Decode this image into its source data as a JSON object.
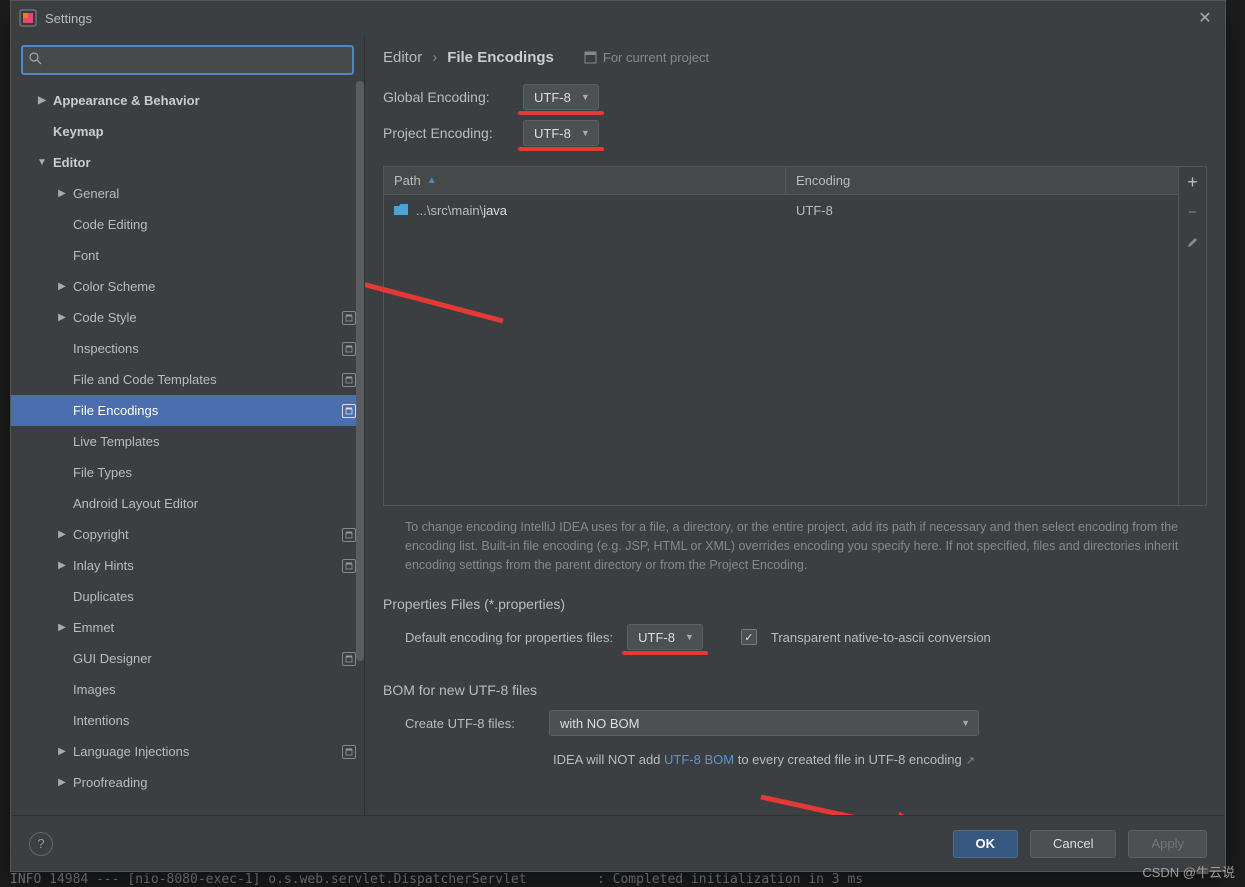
{
  "window": {
    "title": "Settings"
  },
  "search": {
    "value": "",
    "placeholder": ""
  },
  "tree": [
    {
      "label": "Appearance & Behavior",
      "level": 1,
      "arrow": "right",
      "bold": true
    },
    {
      "label": "Keymap",
      "level": 1,
      "arrow": "none",
      "bold": true
    },
    {
      "label": "Editor",
      "level": 1,
      "arrow": "down",
      "bold": true
    },
    {
      "label": "General",
      "level": 2,
      "arrow": "right"
    },
    {
      "label": "Code Editing",
      "level": 2,
      "arrow": "none"
    },
    {
      "label": "Font",
      "level": 2,
      "arrow": "none"
    },
    {
      "label": "Color Scheme",
      "level": 2,
      "arrow": "right"
    },
    {
      "label": "Code Style",
      "level": 2,
      "arrow": "right",
      "badge": true
    },
    {
      "label": "Inspections",
      "level": 2,
      "arrow": "none",
      "badge": true
    },
    {
      "label": "File and Code Templates",
      "level": 2,
      "arrow": "none",
      "badge": true
    },
    {
      "label": "File Encodings",
      "level": 2,
      "arrow": "none",
      "badge": true,
      "selected": true
    },
    {
      "label": "Live Templates",
      "level": 2,
      "arrow": "none"
    },
    {
      "label": "File Types",
      "level": 2,
      "arrow": "none"
    },
    {
      "label": "Android Layout Editor",
      "level": 2,
      "arrow": "none"
    },
    {
      "label": "Copyright",
      "level": 2,
      "arrow": "right",
      "badge": true
    },
    {
      "label": "Inlay Hints",
      "level": 2,
      "arrow": "right",
      "badge": true
    },
    {
      "label": "Duplicates",
      "level": 2,
      "arrow": "none"
    },
    {
      "label": "Emmet",
      "level": 2,
      "arrow": "right"
    },
    {
      "label": "GUI Designer",
      "level": 2,
      "arrow": "none",
      "badge": true
    },
    {
      "label": "Images",
      "level": 2,
      "arrow": "none"
    },
    {
      "label": "Intentions",
      "level": 2,
      "arrow": "none"
    },
    {
      "label": "Language Injections",
      "level": 2,
      "arrow": "right",
      "badge": true
    },
    {
      "label": "Proofreading",
      "level": 2,
      "arrow": "right"
    }
  ],
  "breadcrumb": {
    "root": "Editor",
    "current": "File Encodings",
    "scope": "For current project"
  },
  "global": {
    "label": "Global Encoding:",
    "value": "UTF-8"
  },
  "project": {
    "label": "Project Encoding:",
    "value": "UTF-8"
  },
  "table": {
    "col_path": "Path",
    "col_enc": "Encoding",
    "rows": [
      {
        "path": "...\\src\\main\\java",
        "enc": "UTF-8"
      }
    ]
  },
  "hint_text": "To change encoding IntelliJ IDEA uses for a file, a directory, or the entire project, add its path if necessary and then select encoding from the encoding list. Built-in file encoding (e.g. JSP, HTML or XML) overrides encoding you specify here. If not specified, files and directories inherit encoding settings from the parent directory or from the Project Encoding.",
  "properties": {
    "title": "Properties Files (*.properties)",
    "label": "Default encoding for properties files:",
    "value": "UTF-8",
    "checkbox_label": "Transparent native-to-ascii conversion",
    "checked": true
  },
  "bom": {
    "title": "BOM for new UTF-8 files",
    "label": "Create UTF-8 files:",
    "value": "with NO BOM",
    "note_prefix": "IDEA will NOT add ",
    "note_link": "UTF-8 BOM",
    "note_suffix": " to every created file in UTF-8 encoding"
  },
  "footer": {
    "ok": "OK",
    "cancel": "Cancel",
    "apply": "Apply"
  },
  "watermark": "CSDN @牛云说"
}
